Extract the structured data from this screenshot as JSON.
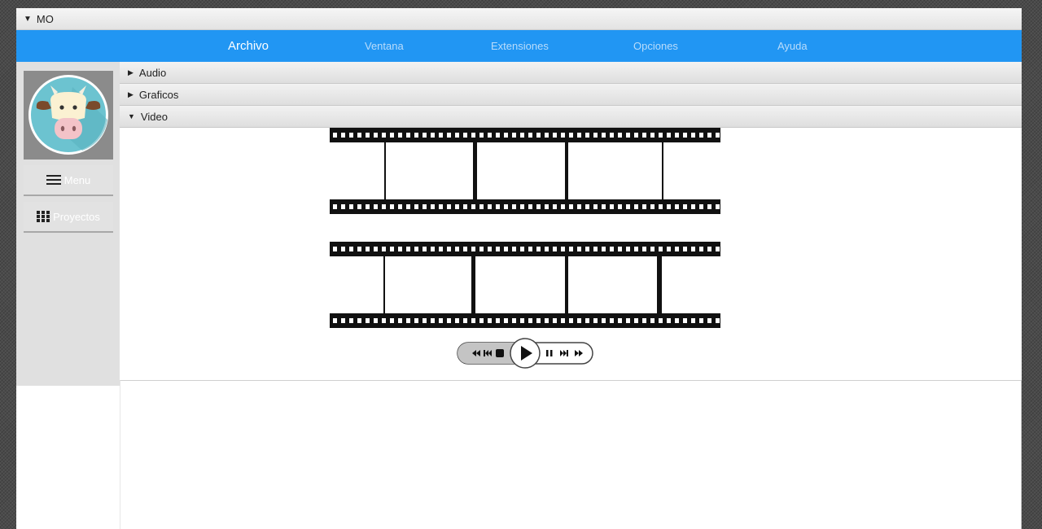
{
  "window": {
    "title": "MO"
  },
  "menubar": {
    "items": [
      {
        "label": "Archivo",
        "active": true
      },
      {
        "label": "Ventana",
        "active": false
      },
      {
        "label": "Extensiones",
        "active": false
      },
      {
        "label": "Opciones",
        "active": false
      },
      {
        "label": "Ayuda",
        "active": false
      }
    ]
  },
  "sidebar": {
    "avatar_icon": "cow-face-icon",
    "buttons": [
      {
        "label": "Menu",
        "icon": "hamburger-icon"
      },
      {
        "label": "Proyectos",
        "icon": "grid-icon"
      }
    ]
  },
  "panels": [
    {
      "label": "Audio",
      "expanded": false
    },
    {
      "label": "Graficos",
      "expanded": false
    },
    {
      "label": "Video",
      "expanded": true
    }
  ],
  "player": {
    "controls": [
      "rewind-icon",
      "skip-back-icon",
      "stop-icon",
      "play-icon",
      "pause-icon",
      "skip-forward-icon",
      "fast-forward-icon"
    ]
  },
  "colors": {
    "accent": "#2196f3",
    "sidebar": "#e0e0e0",
    "avatar_bg": "#8b8b8b",
    "avatar_circle": "#6cc3d0"
  }
}
